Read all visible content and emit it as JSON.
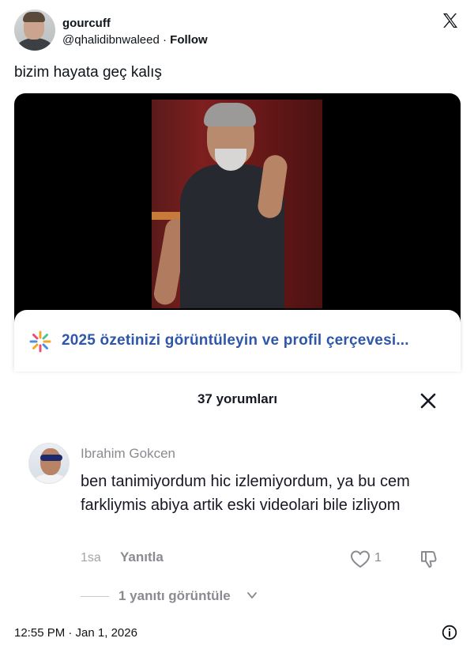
{
  "tweet": {
    "author_name": "gourcuff",
    "handle": "@qhalidibnwaleed",
    "separator": " · ",
    "follow_label": "Follow",
    "text": "bizim hayata geç kalış",
    "timestamp": "12:55 PM · Jan 1, 2026"
  },
  "promo": {
    "text": "2025 özetinizi görüntüleyin ve profil çerçevesi...",
    "accent_color": "#2f57a8"
  },
  "comments": {
    "count_label": "37 yorumları"
  },
  "comment": {
    "author": "Ibrahim Gokcen",
    "text": "ben tanimiyordum hic izlemiyordum, ya bu cem farkliymis abiya artik eski videolari bile izliyom",
    "time_ago": "1sa",
    "reply_label": "Yanıtla",
    "like_count": "1",
    "view_replies_label": "1 yanıtı görüntüle"
  },
  "icons": {
    "x_logo": "x-logo-icon",
    "promo": "sparkle-icon",
    "close": "close-icon",
    "like": "heart-icon",
    "dislike": "thumbs-down-icon",
    "chevron": "chevron-down-icon",
    "info": "info-icon"
  }
}
